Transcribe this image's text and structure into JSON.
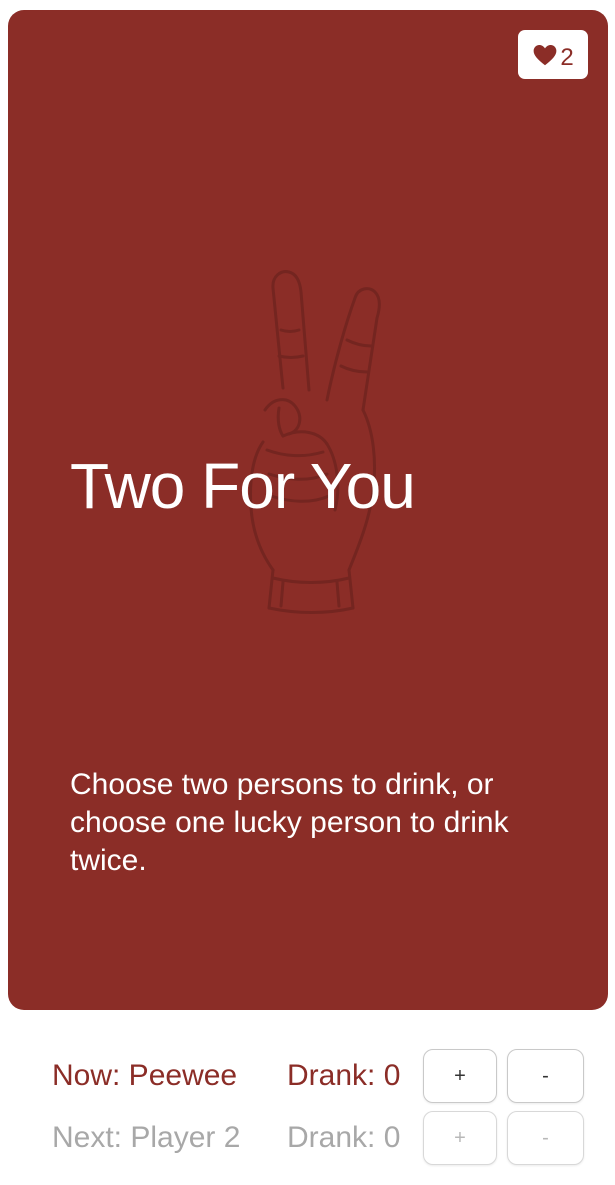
{
  "card": {
    "background_color": "#8b2d27",
    "badge": {
      "icon": "heart-icon",
      "count": "2"
    },
    "illustration": "peace-sign-hand",
    "title": "Two For You",
    "description": "Choose two persons to drink, or choose one lucky person to drink twice."
  },
  "players": {
    "current": {
      "label": "Now: Peewee",
      "drank": "Drank: 0",
      "plus_label": "+",
      "minus_label": "-"
    },
    "next": {
      "label": "Next: Player 2",
      "drank": "Drank: 0",
      "plus_label": "+",
      "minus_label": "-"
    }
  }
}
